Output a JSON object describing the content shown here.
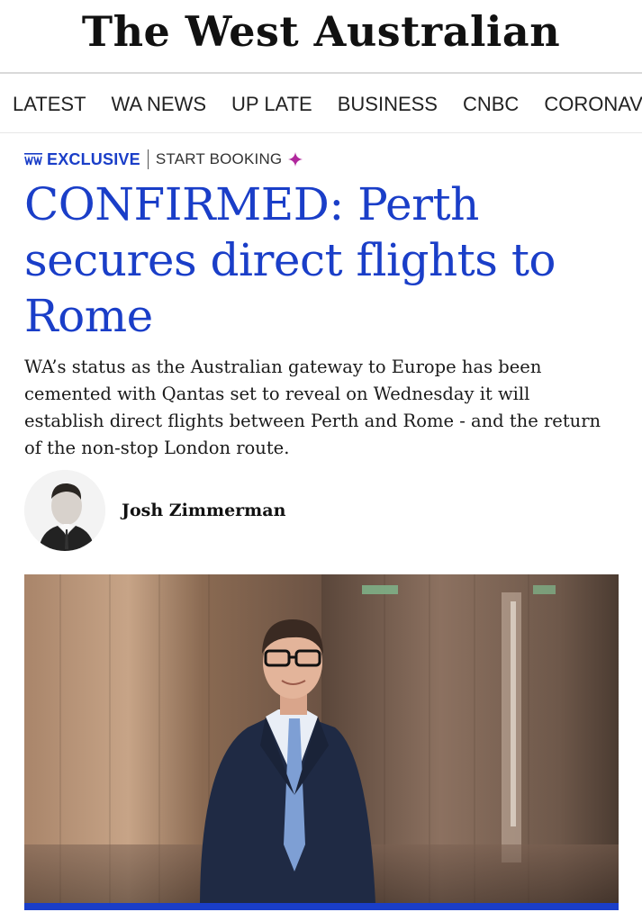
{
  "masthead": {
    "title": "The West Australian"
  },
  "nav": {
    "items": [
      {
        "label": "LATEST"
      },
      {
        "label": "WA NEWS"
      },
      {
        "label": "UP LATE"
      },
      {
        "label": "BUSINESS"
      },
      {
        "label": "CNBC"
      },
      {
        "label": "CORONAVIRUS"
      }
    ]
  },
  "article": {
    "kicker": {
      "label": "EXCLUSIVE",
      "link": "START BOOKING"
    },
    "headline": "CONFIRMED: Perth secures direct flights to Rome",
    "standfirst": "WA’s status as the Australian gateway to Europe has been cemented with Qantas set to reveal on Wednesday it will establish direct flights between Perth and Rome - and the return of the non-stop London route.",
    "author": "Josh Zimmerman"
  },
  "colors": {
    "accent": "#1a3ec8",
    "plus_icon": "#b0279c"
  }
}
